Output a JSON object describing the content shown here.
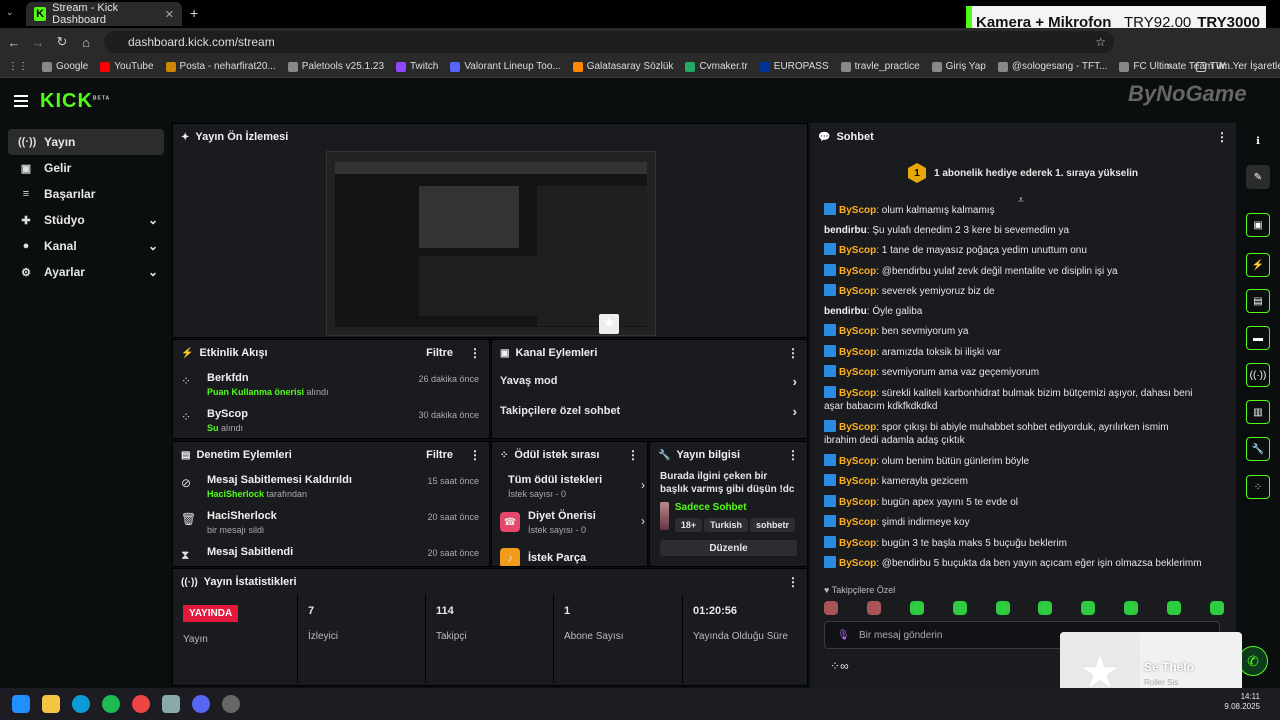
{
  "browser": {
    "tab_title": "Stream - Kick Dashboard",
    "url": "dashboard.kick.com/stream",
    "bookmarks": [
      "Google",
      "YouTube",
      "Posta - neharfirat20...",
      "Paletools v25.1.23",
      "Twitch",
      "Valorant Lineup Too...",
      "Galatasaray Sözlük",
      "Cvmaker.tr",
      "EUROPASS",
      "travle_practice",
      "Giriş Yap",
      "@sologesang - TFT...",
      "FC Ultimate Team W..."
    ],
    "bookmarks_all": "Tüm Yer İşaretleri"
  },
  "overlay": {
    "label": "Kamera + Mikrofon",
    "price1": "TRY92.00",
    "price2": "TRY3000",
    "watermark": "ByNoGame"
  },
  "sidebar": {
    "items": [
      {
        "label": "Yayın",
        "icon": "broadcast-icon"
      },
      {
        "label": "Gelir",
        "icon": "dollar-icon"
      },
      {
        "label": "Başarılar",
        "icon": "list-icon"
      },
      {
        "label": "Stüdyo",
        "icon": "studio-icon"
      },
      {
        "label": "Kanal",
        "icon": "user-icon"
      },
      {
        "label": "Ayarlar",
        "icon": "gear-icon"
      }
    ]
  },
  "preview": {
    "title": "Yayın Ön İzlemesi"
  },
  "activity": {
    "title": "Etkinlik Akışı",
    "filter": "Filtre",
    "rows": [
      {
        "name": "Berkfdn",
        "highlight": "Puan Kullanma önerisi",
        "rest": " alındı",
        "time": "26 dakika önce"
      },
      {
        "name": "ByScop",
        "highlight": "Su",
        "rest": " alındı",
        "time": "30 dakika önce"
      }
    ]
  },
  "channel_actions": {
    "title": "Kanal Eylemleri",
    "rows": [
      "Yavaş mod",
      "Takipçilere özel sohbet"
    ]
  },
  "moderation": {
    "title": "Denetim Eylemleri",
    "filter": "Filtre",
    "rows": [
      {
        "name": "Mesaj Sabitlemesi Kaldırıldı",
        "highlight": "HaciSherlock",
        "rest": " tarafından",
        "time": "15 saat önce"
      },
      {
        "name": "HaciSherlock",
        "highlight": "",
        "rest": "bir mesajı sildi",
        "time": "20 saat önce"
      },
      {
        "name": "Mesaj Sabitlendi",
        "highlight": "",
        "rest": "",
        "time": "20 saat önce"
      }
    ]
  },
  "rewards": {
    "title": "Ödül istek sırası",
    "rows": [
      {
        "name": "Tüm ödül istekleri",
        "sub": "İstek sayısı - 0"
      },
      {
        "name": "Diyet Önerisi",
        "sub": "İstek sayısı - 0"
      },
      {
        "name": "İstek Parça",
        "sub": ""
      }
    ]
  },
  "stream_info": {
    "title": "Yayın bilgisi",
    "stream_title": "Burada ilgini çeken bir başlık varmış gibi düşün !dc",
    "category": "Sadece Sohbet",
    "tags": [
      "18+",
      "Turkish",
      "sohbetr"
    ],
    "edit": "Düzenle"
  },
  "stats": {
    "title": "Yayın İstatistikleri",
    "live": "YAYINDA",
    "items": [
      {
        "value": "",
        "label": "Yayın"
      },
      {
        "value": "7",
        "label": "İzleyici"
      },
      {
        "value": "114",
        "label": "Takipçi"
      },
      {
        "value": "1",
        "label": "Abone Sayısı"
      },
      {
        "value": "01:20:56",
        "label": "Yayında Olduğu Süre"
      }
    ]
  },
  "chat": {
    "title": "Sohbet",
    "banner": "1 abonelik hediye ederek 1. sıraya yükselin",
    "banner_num": "1",
    "messages": [
      {
        "user": "ByScop",
        "text": ": olum kalmamış kalmamış",
        "badge": true
      },
      {
        "user": "bendirbu",
        "text": ": Şu yulafı denedim 2 3 kere bi sevemedim ya",
        "badge": false
      },
      {
        "user": "ByScop",
        "text": ": 1 tane de mayasız poğaça yedim unuttum onu",
        "badge": true
      },
      {
        "user": "ByScop",
        "text": ": @bendirbu yulaf zevk değil mentalite ve disiplin işi ya",
        "badge": true
      },
      {
        "user": "ByScop",
        "text": ": severek yemiyoruz biz de",
        "badge": true
      },
      {
        "user": "bendirbu",
        "text": ": Öyle galiba",
        "badge": false
      },
      {
        "user": "ByScop",
        "text": ": ben sevmiyorum ya",
        "badge": true
      },
      {
        "user": "ByScop",
        "text": ": aramızda toksik bi ilişki var",
        "badge": true
      },
      {
        "user": "ByScop",
        "text": ": sevmiyorum ama vaz geçemiyorum",
        "badge": true
      },
      {
        "user": "ByScop",
        "text": ": sürekli kaliteli karbonhidrat bulmak bizim bütçemizi aşıyor, dahası beni aşar babacım kdkfkdkdkd",
        "badge": true
      },
      {
        "user": "ByScop",
        "text": ": spor çıkışı bi abiyle muhabbet sohbet ediyorduk, ayrılırken ismim ibrahim dedi adamla adaş çıktık",
        "badge": true
      },
      {
        "user": "ByScop",
        "text": ": olum benim bütün günlerim böyle",
        "badge": true
      },
      {
        "user": "ByScop",
        "text": ": kamerayla gezicem",
        "badge": true
      },
      {
        "user": "ByScop",
        "text": ": bugün apex yayını 5 te evde ol",
        "badge": true
      },
      {
        "user": "ByScop",
        "text": ": şimdi indirmeye koy",
        "badge": true
      },
      {
        "user": "ByScop",
        "text": ": bugün 3 te başla maks 5 buçuğu beklerim",
        "badge": true
      },
      {
        "user": "ByScop",
        "text": ": @bendirbu 5 buçukta da ben yayın açıcam eğer işin olmazsa beklerimm",
        "badge": true
      }
    ],
    "followers_only": "Takipçilere Özel",
    "input_placeholder": "Bir mesaj gönderin",
    "points": "∞"
  },
  "toast": {
    "title": "Se Thelo",
    "subtitle": "Roller Sis"
  },
  "taskbar": {
    "time": "14:11",
    "date": "9.08.2025"
  },
  "colors": {
    "accent": "#53fc18",
    "live": "#e3193b",
    "chat_user": "#ffb020"
  }
}
